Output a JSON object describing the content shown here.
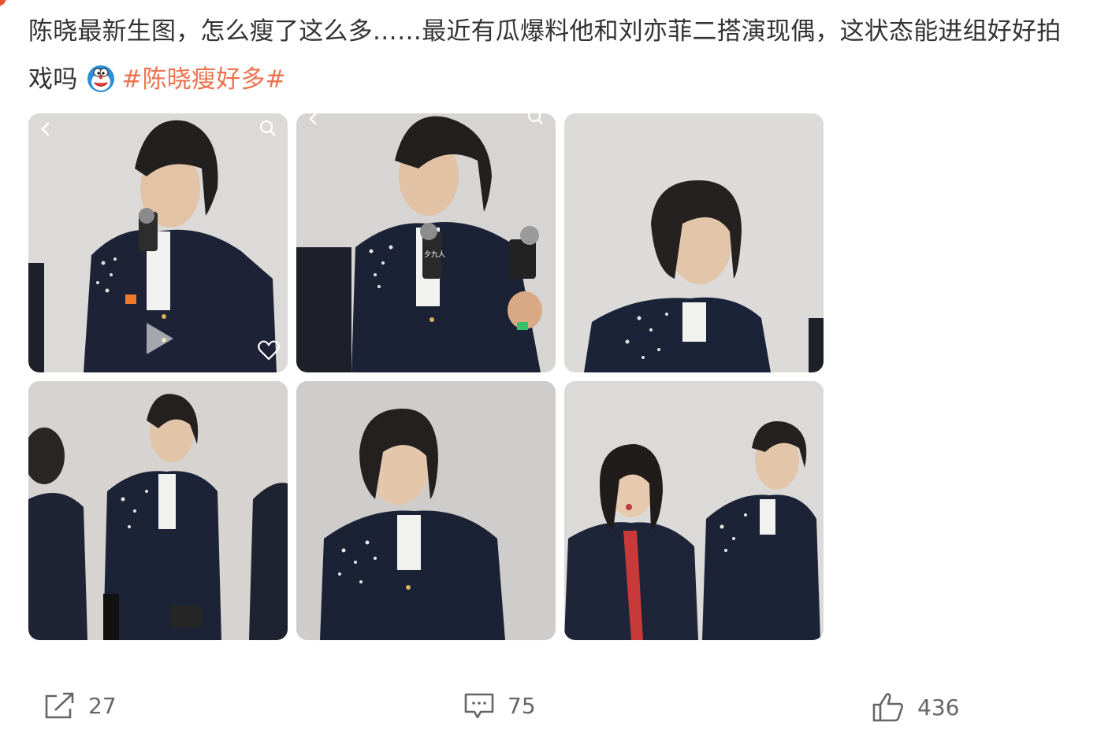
{
  "post": {
    "text_main": "陈晓最新生图，怎么瘦了这么多……最近有瓜爆料他和刘亦菲二搭演现偶，这状态能进组好好拍戏吗",
    "hashtag": "#陈晓瘦好多#"
  },
  "photo_labels": {
    "mic_logo": "夕九人",
    "mic_logo_2": "夕九人"
  },
  "actions": {
    "share_count": "27",
    "comment_count": "75",
    "like_count": "436"
  },
  "colors": {
    "hashtag": "#eb7350",
    "text": "#333333",
    "muted": "#666666"
  }
}
